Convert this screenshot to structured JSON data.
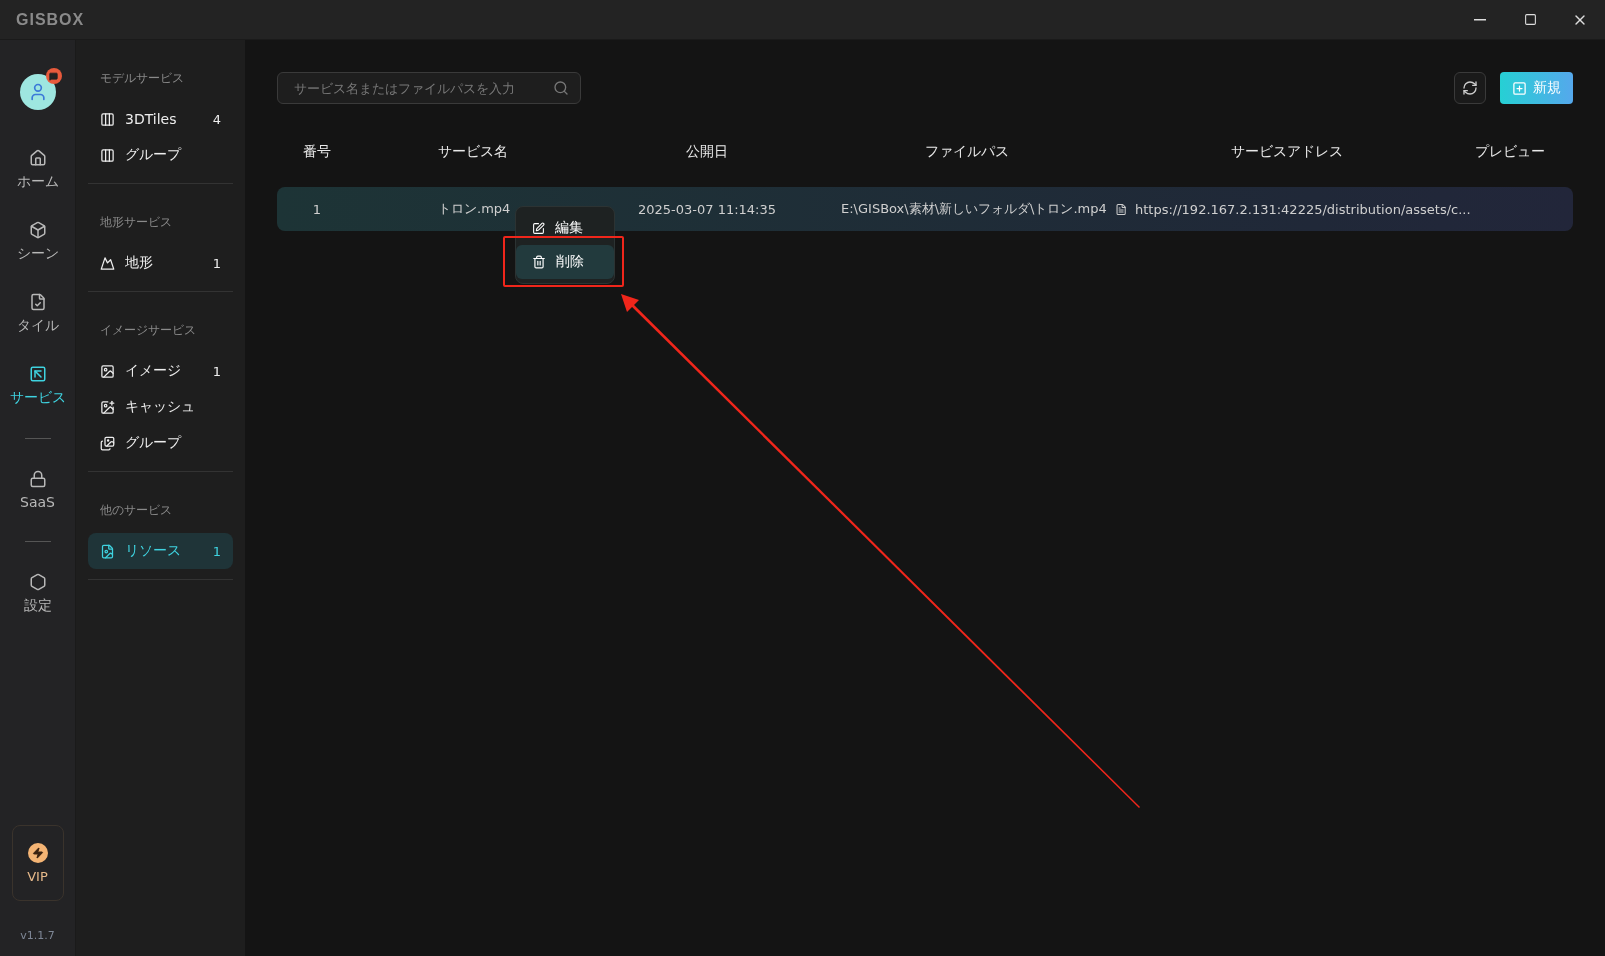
{
  "window": {
    "logo": "GISBOX"
  },
  "rail": {
    "items": [
      {
        "kind": "home",
        "label": "ホーム",
        "selected": false
      },
      {
        "kind": "scene",
        "label": "シーン",
        "selected": false
      },
      {
        "kind": "tile",
        "label": "タイル",
        "selected": false
      },
      {
        "kind": "service",
        "label": "サービス",
        "selected": true
      },
      {
        "kind": "divider"
      },
      {
        "kind": "saas",
        "label": "SaaS",
        "selected": false
      },
      {
        "kind": "divider"
      },
      {
        "kind": "settings",
        "label": "設定",
        "selected": false
      }
    ],
    "vip": "VIP",
    "version": "v1.1.7"
  },
  "sidebar": {
    "sections": [
      {
        "title": "モデルサービス",
        "items": [
          {
            "kind": "model",
            "label": "3DTiles",
            "count": "4",
            "selected": false
          },
          {
            "kind": "model",
            "label": "グループ",
            "selected": false
          }
        ]
      },
      {
        "title": "地形サービス",
        "items": [
          {
            "kind": "terrain",
            "label": "地形",
            "count": "1",
            "selected": false
          }
        ]
      },
      {
        "title": "イメージサービス",
        "items": [
          {
            "kind": "image",
            "label": "イメージ",
            "count": "1",
            "selected": false
          },
          {
            "kind": "cache",
            "label": "キャッシュ",
            "selected": false
          },
          {
            "kind": "group",
            "label": "グループ",
            "selected": false
          }
        ]
      },
      {
        "title": "他のサービス",
        "items": [
          {
            "kind": "resource",
            "label": "リソース",
            "count": "1",
            "selected": true
          }
        ]
      }
    ]
  },
  "search": {
    "placeholder": "サービス名またはファイルパスを入力"
  },
  "new_button": "新規",
  "table": {
    "columns": [
      "番号",
      "サービス名",
      "公開日",
      "ファイルパス",
      "サービスアドレス",
      "プレビュー"
    ],
    "rows": [
      {
        "number": "1",
        "name": "トロン.mp4",
        "date": "2025-03-07 11:14:35",
        "path": "E:\\GISBox\\素材\\新しいフォルダ\\トロン.mp4",
        "address": "https://192.167.2.131:42225/distribution/assets/c..."
      }
    ]
  },
  "context_menu": {
    "items": [
      {
        "kind": "edit",
        "label": "編集",
        "selected": false
      },
      {
        "kind": "delete",
        "label": "削除",
        "selected": true
      }
    ]
  }
}
